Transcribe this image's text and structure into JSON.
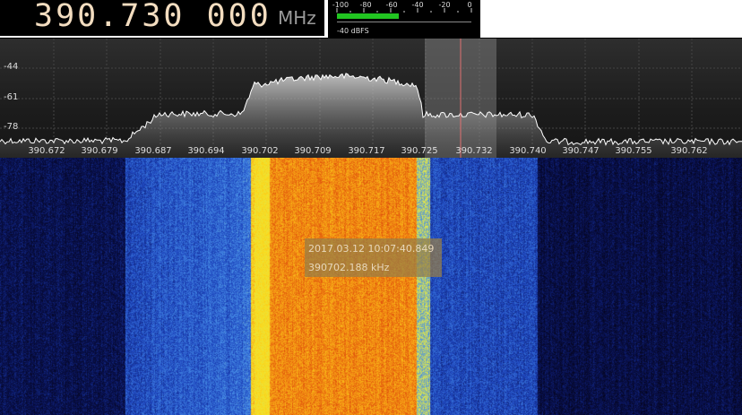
{
  "frequency": {
    "value": "390.730 000",
    "unit": "MHz"
  },
  "signal_meter": {
    "scale_labels": [
      "-100",
      "-80",
      "-60",
      "-40",
      "-20",
      "0"
    ],
    "level": 0.46,
    "readout": "-40 dBFS",
    "bar_color": "#21c521"
  },
  "spectrum": {
    "db_labels": [
      "-44",
      "-61",
      "-78"
    ],
    "freq_labels": [
      "390.672",
      "390.679",
      "390.687",
      "390.694",
      "390.702",
      "390.709",
      "390.717",
      "390.725",
      "390.732",
      "390.740",
      "390.747",
      "390.755",
      "390.762"
    ],
    "tuned_line_color": "#e07070"
  },
  "waterfall": {
    "tooltip": {
      "time": "2017.03.12 10:07:40.849",
      "freq": "390702.188 kHz"
    }
  }
}
